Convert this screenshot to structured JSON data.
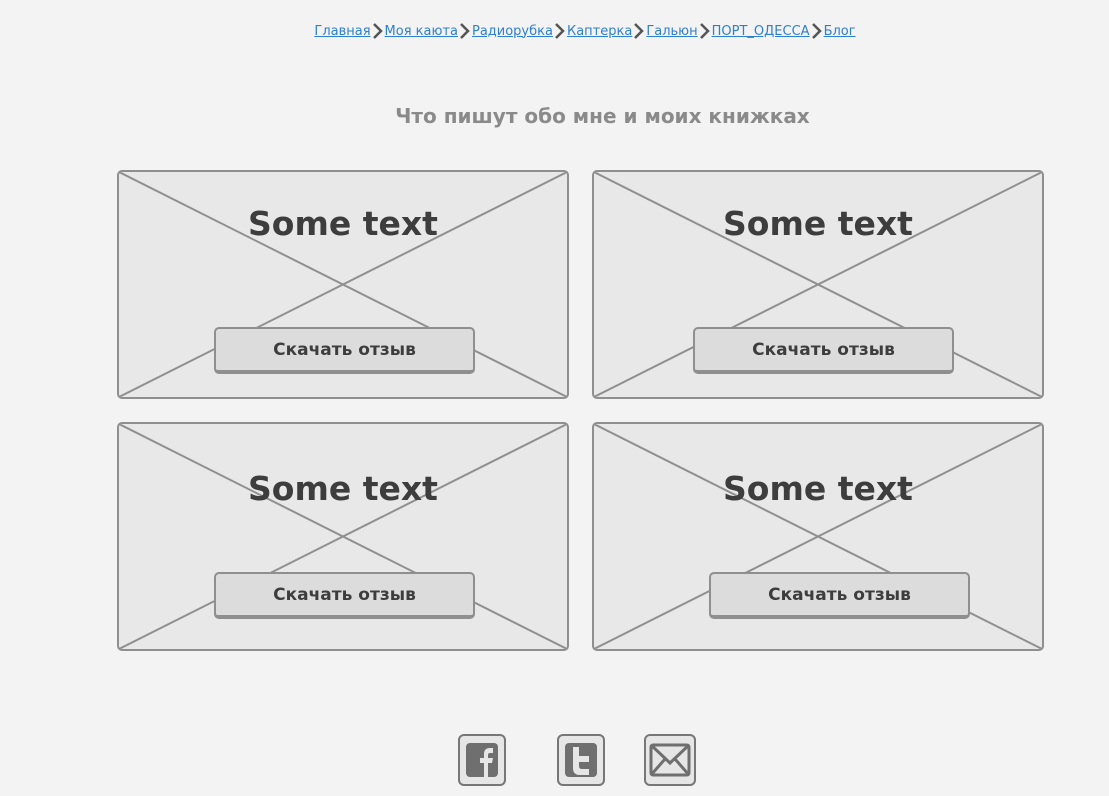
{
  "breadcrumb": {
    "items": [
      {
        "label": "Главная"
      },
      {
        "label": "Моя каюта"
      },
      {
        "label": "Радиорубка"
      },
      {
        "label": "Каптерка"
      },
      {
        "label": "Гальюн"
      },
      {
        "label": "ПОРТ_ОДЕССА"
      },
      {
        "label": "Блог"
      }
    ]
  },
  "main": {
    "title": "Что пишут обо мне и моих книжках",
    "cards": [
      {
        "text": "Some text",
        "button_label": "Скачать отзыв"
      },
      {
        "text": "Some text",
        "button_label": "Скачать отзыв"
      },
      {
        "text": "Some text",
        "button_label": "Скачать отзыв"
      },
      {
        "text": "Some text",
        "button_label": "Скачать отзыв"
      }
    ]
  },
  "footer": {
    "social": [
      {
        "icon": "facebook-icon"
      },
      {
        "icon": "twitter-icon"
      },
      {
        "icon": "mail-icon"
      }
    ]
  },
  "colors": {
    "background": "#f3f3f3",
    "link": "#2f7fd0",
    "placeholder_fill": "#e8e8e8",
    "border": "#8f8f8f",
    "title_text": "#8a8a8a",
    "card_text": "#3d3d3d"
  }
}
